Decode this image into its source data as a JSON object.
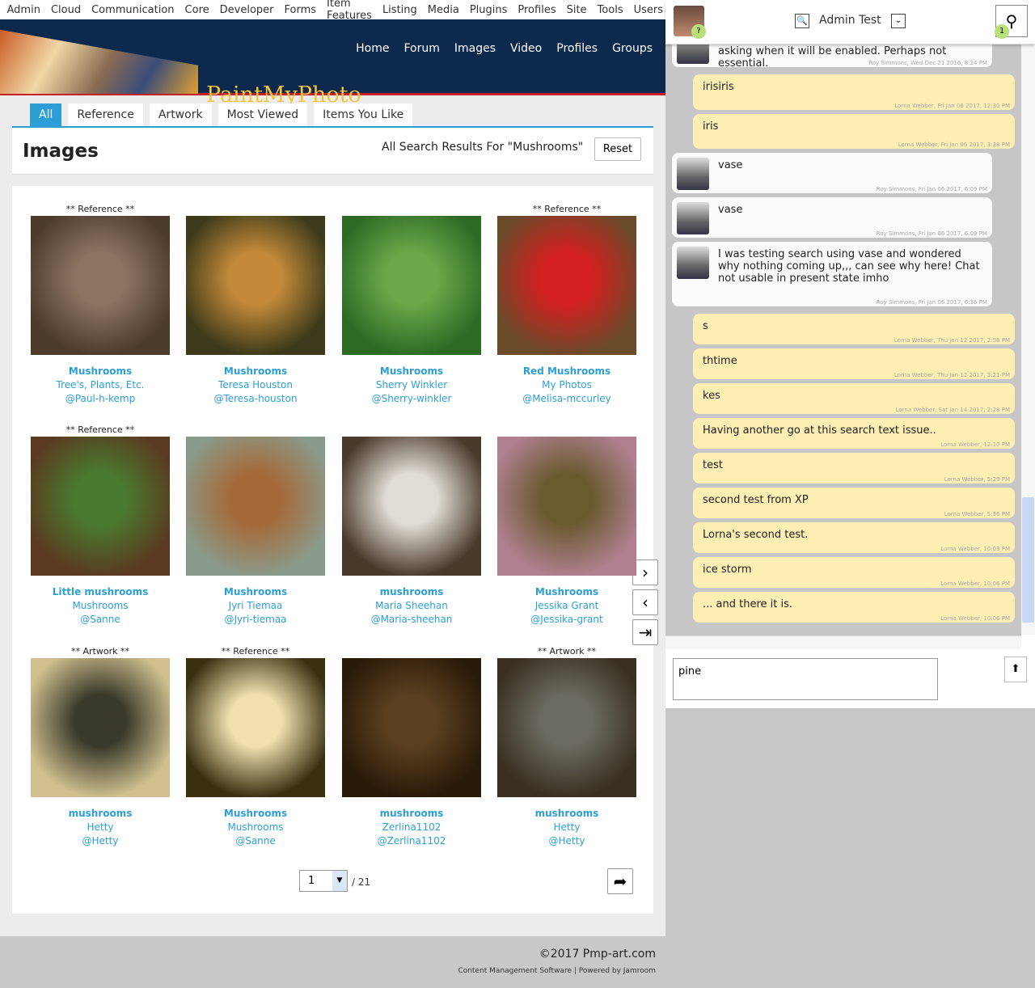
{
  "admin_menu": [
    "Admin",
    "Cloud",
    "Communication",
    "Core",
    "Developer",
    "Forms",
    "Item Features",
    "Listing",
    "Media",
    "Plugins",
    "Profiles",
    "Site",
    "Tools",
    "Users"
  ],
  "site": {
    "logo": "PaintMyPhoto",
    "nav": [
      "Home",
      "Forum",
      "Images",
      "Video",
      "Profiles",
      "Groups"
    ]
  },
  "tabs": [
    "All",
    "Reference",
    "Artwork",
    "Most Viewed",
    "Items You Like"
  ],
  "page": {
    "title": "Images",
    "results": "All Search Results For \"Mushrooms\"",
    "reset": "Reset"
  },
  "images": [
    {
      "tag": "** Reference **",
      "title": "Mushrooms",
      "sub": "Tree's, Plants, Etc.",
      "user": "@Paul-h-kemp",
      "c": [
        "#8a7560",
        "#4d3b2c"
      ]
    },
    {
      "tag": "",
      "title": "Mushrooms",
      "sub": "Teresa Houston",
      "user": "@Teresa-houston",
      "c": [
        "#c48a3a",
        "#3c3a1a"
      ]
    },
    {
      "tag": "",
      "title": "Mushrooms",
      "sub": "Sherry Winkler",
      "user": "@Sherry-winkler",
      "c": [
        "#6aa84a",
        "#2f6a25"
      ]
    },
    {
      "tag": "** Reference **",
      "title": "Red Mushrooms",
      "sub": "My Photos",
      "user": "@Melisa-mccurley",
      "c": [
        "#d42020",
        "#6b4a2a"
      ]
    },
    {
      "tag": "** Reference **",
      "title": "Little mushrooms",
      "sub": "Mushrooms",
      "user": "@Sanne",
      "c": [
        "#4a7a30",
        "#5a3a20"
      ]
    },
    {
      "tag": "",
      "title": "Mushrooms",
      "sub": "Jyri Tiemaa",
      "user": "@Jyri-tiemaa",
      "c": [
        "#a56a3a",
        "#8a9a8a"
      ]
    },
    {
      "tag": "",
      "title": "mushrooms",
      "sub": "Maria Sheehan",
      "user": "@Maria-sheehan",
      "c": [
        "#e0dcd4",
        "#4a3a2a"
      ]
    },
    {
      "tag": "",
      "title": "Mushrooms",
      "sub": "Jessika Grant",
      "user": "@Jessika-grant",
      "c": [
        "#6a5a30",
        "#b08090"
      ]
    },
    {
      "tag": "** Artwork **",
      "title": "mushrooms",
      "sub": "Hetty",
      "user": "@Hetty",
      "c": [
        "#3a3a2a",
        "#d0c090"
      ]
    },
    {
      "tag": "** Reference **",
      "title": "Mushrooms",
      "sub": "Mushrooms",
      "user": "@Sanne",
      "c": [
        "#f0e0b0",
        "#3a3010"
      ]
    },
    {
      "tag": "",
      "title": "mushrooms",
      "sub": "Zerlina1102",
      "user": "@Zerlina1102",
      "c": [
        "#5a4020",
        "#2a1a08"
      ]
    },
    {
      "tag": "** Artwork **",
      "title": "mushrooms",
      "sub": "Hetty",
      "user": "@Hetty",
      "c": [
        "#6a6a60",
        "#3a3020"
      ]
    }
  ],
  "pagination": {
    "page": "1",
    "total": "/ 21"
  },
  "footer": {
    "copyright": "©2017 Pmp-art.com",
    "credits": "Content Management Software | Powered by Jamroom"
  },
  "chat": {
    "user": "Admin Test",
    "badge_left": "?",
    "badge_right": "1",
    "input": "pine",
    "messages": [
      {
        "side": "them",
        "text": "chat. Maybe hold off, no one has come back asking when it will be enabled. Perhaps not essential.",
        "ts": "Roy Simmons, Wed Dec 21 2016, 8:24 PM"
      },
      {
        "side": "me",
        "text": "irisiris",
        "ts": "Lorna Webber, Fri Jan 06 2017, 12:30 PM"
      },
      {
        "side": "me",
        "text": "iris",
        "ts": "Lorna Webber, Fri Jan 06 2017, 3:38 PM"
      },
      {
        "side": "them",
        "text": "vase",
        "ts": "Roy Simmons, Fri Jan 06 2017, 6:09 PM"
      },
      {
        "side": "them",
        "text": "vase",
        "ts": "Roy Simmons, Fri Jan 06 2017, 6:09 PM"
      },
      {
        "side": "them",
        "text": "I was testing search using vase and wondered why nothing coming up,,, can see why here! Chat not usable in present state imho",
        "ts": "Roy Simmons, Fri Jan 06 2017, 6:36 PM"
      },
      {
        "side": "me",
        "text": "s",
        "ts": "Lorna Webber, Thu Jan 12 2017, 2:58 PM"
      },
      {
        "side": "me",
        "text": "thtime",
        "ts": "Lorna Webber, Thu Jan 12 2017, 3:21 PM"
      },
      {
        "side": "me",
        "text": "kes",
        "ts": "Lorna Webber, Sat Jan 14 2017, 2:28 PM"
      },
      {
        "side": "me",
        "text": "Having another go at this search text issue..",
        "ts": "Lorna Webber, 12:10 PM"
      },
      {
        "side": "me",
        "text": "test",
        "ts": "Lorna Webber, 5:29 PM"
      },
      {
        "side": "me",
        "text": "second test from XP",
        "ts": "Lorna Webber, 5:36 PM"
      },
      {
        "side": "me",
        "text": "Lorna's second test.",
        "ts": "Lorna Webber, 10:03 PM"
      },
      {
        "side": "me",
        "text": "ice storm",
        "ts": "Lorna Webber, 10:06 PM"
      },
      {
        "side": "me",
        "text": "... and there it is.",
        "ts": "Lorna Webber, 10:06 PM"
      }
    ]
  }
}
